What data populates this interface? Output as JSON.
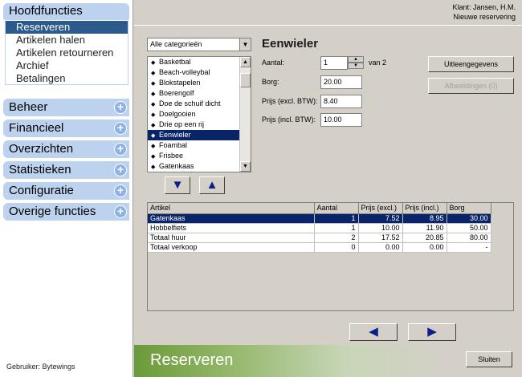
{
  "sidebar": {
    "main_header": "Hoofdfuncties",
    "main_items": [
      "Reserveren",
      "Artikelen halen",
      "Artikelen retourneren",
      "Archief",
      "Betalingen"
    ],
    "groups": [
      "Beheer",
      "Financieel",
      "Overzichten",
      "Statistieken",
      "Configuratie",
      "Overige functies"
    ],
    "plus_symbol": "+",
    "user": "Gebruiker: Bytewings"
  },
  "header": {
    "client": "Klant: Jansen, H.M.",
    "status": "Nieuwe reservering"
  },
  "category": {
    "selected": "Alle categorieën",
    "items": [
      "Basketbal",
      "Beach-volleybal",
      "Blokstapelen",
      "Boerengolf",
      "Doe de schuif dicht",
      "Doelgooien",
      "Drie op een rij",
      "Eenwieler",
      "Foambal",
      "Frisbee",
      "Gatenkaas"
    ],
    "selected_index": 7
  },
  "product": {
    "title": "Eenwieler",
    "aantal_label": "Aantal:",
    "aantal_value": "1",
    "van_text": "van 2",
    "borg_label": "Borg:",
    "borg_value": "20.00",
    "prijs_excl_label": "Prijs (excl. BTW):",
    "prijs_excl_value": "8.40",
    "prijs_incl_label": "Prijs (incl. BTW):",
    "prijs_incl_value": "10.00",
    "uitleg_button": "Uitleengegevens",
    "afbeeldingen_button": "Afbeeldingen (0)"
  },
  "grid": {
    "headers": [
      "Artikel",
      "Aantal",
      "Prijs (excl.)",
      "Prijs (incl.)",
      "Borg"
    ],
    "rows": [
      [
        "Gatenkaas",
        "1",
        "7.52",
        "8.95",
        "30.00"
      ],
      [
        "Hobbelfiets",
        "1",
        "10.00",
        "11.90",
        "50.00"
      ],
      [
        "Totaal huur",
        "2",
        "17.52",
        "20.85",
        "80.00"
      ],
      [
        "Totaal verkoop",
        "0",
        "0.00",
        "0.00",
        "-"
      ]
    ],
    "selected_row": 0
  },
  "footer": {
    "screen_title": "Reserveren",
    "close_button": "Sluiten"
  },
  "icons": {
    "down": "▼",
    "up": "▲",
    "left": "◀",
    "right": "▶",
    "bullet": "◆"
  }
}
